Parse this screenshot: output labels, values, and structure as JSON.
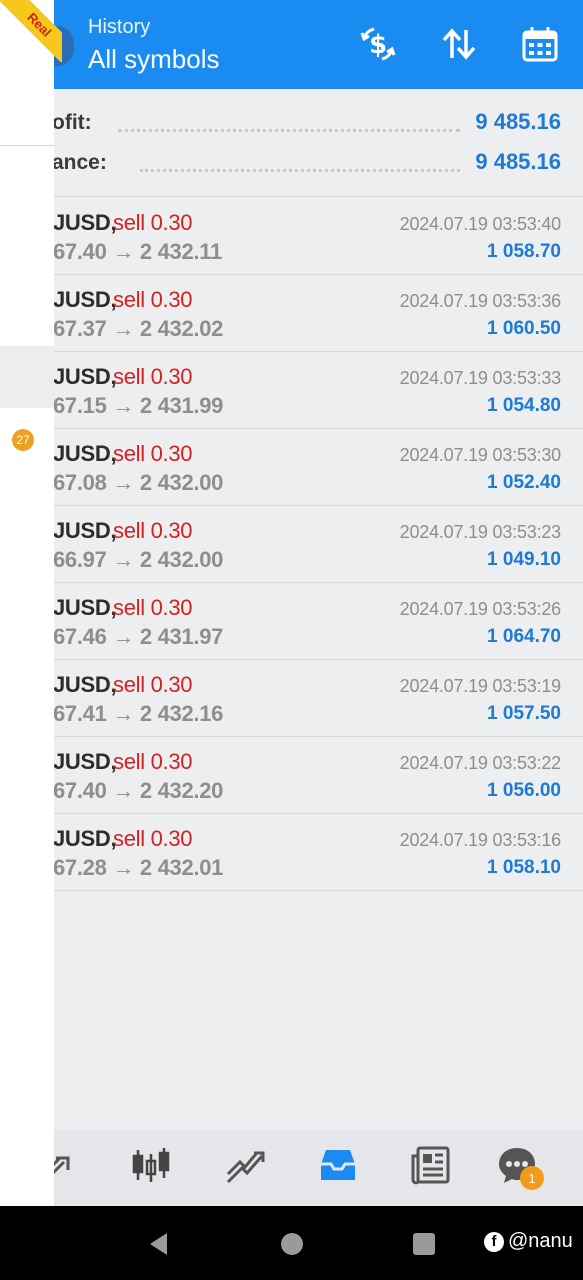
{
  "header": {
    "subtitle": "History",
    "title": "All symbols",
    "actions": [
      "currency-exchange-icon",
      "sort-icon",
      "calendar-icon"
    ],
    "color": "#1a8bf0"
  },
  "ribbon": {
    "label": "Real"
  },
  "drawer": {
    "badge": "27"
  },
  "summary": [
    {
      "label": "ofit:",
      "value": "9 485.16"
    },
    {
      "label": "ance:",
      "value": "9 485.16"
    }
  ],
  "trades": [
    {
      "symbol": "JUSD,",
      "side": "sell 0.30",
      "price": "67.40 → 2 432.11",
      "time": "2024.07.19 03:53:40",
      "profit": "1 058.70"
    },
    {
      "symbol": "JUSD,",
      "side": "sell 0.30",
      "price": "67.37 → 2 432.02",
      "time": "2024.07.19 03:53:36",
      "profit": "1 060.50"
    },
    {
      "symbol": "JUSD,",
      "side": "sell 0.30",
      "price": "67.15 → 2 431.99",
      "time": "2024.07.19 03:53:33",
      "profit": "1 054.80"
    },
    {
      "symbol": "JUSD,",
      "side": "sell 0.30",
      "price": "67.08 → 2 432.00",
      "time": "2024.07.19 03:53:30",
      "profit": "1 052.40"
    },
    {
      "symbol": "JUSD,",
      "side": "sell 0.30",
      "price": "66.97 → 2 432.00",
      "time": "2024.07.19 03:53:23",
      "profit": "1 049.10"
    },
    {
      "symbol": "JUSD,",
      "side": "sell 0.30",
      "price": "67.46 → 2 431.97",
      "time": "2024.07.19 03:53:26",
      "profit": "1 064.70"
    },
    {
      "symbol": "JUSD,",
      "side": "sell 0.30",
      "price": "67.41 → 2 432.16",
      "time": "2024.07.19 03:53:19",
      "profit": "1 057.50"
    },
    {
      "symbol": "JUSD,",
      "side": "sell 0.30",
      "price": "67.40 → 2 432.20",
      "time": "2024.07.19 03:53:22",
      "profit": "1 056.00"
    },
    {
      "symbol": "JUSD,",
      "side": "sell 0.30",
      "price": "67.28 → 2 432.01",
      "time": "2024.07.19 03:53:16",
      "profit": "1 058.10"
    }
  ],
  "tabbar": {
    "tabs": [
      "quotes-icon",
      "chart-icon",
      "trade-icon",
      "history-icon",
      "news-icon",
      "chat-icon"
    ],
    "active": "history-icon",
    "chat_badge": "1",
    "active_color": "#1a8bf0"
  },
  "system_nav": [
    "back-icon",
    "home-icon",
    "recents-icon"
  ],
  "watermark": {
    "text": "@nanu"
  }
}
